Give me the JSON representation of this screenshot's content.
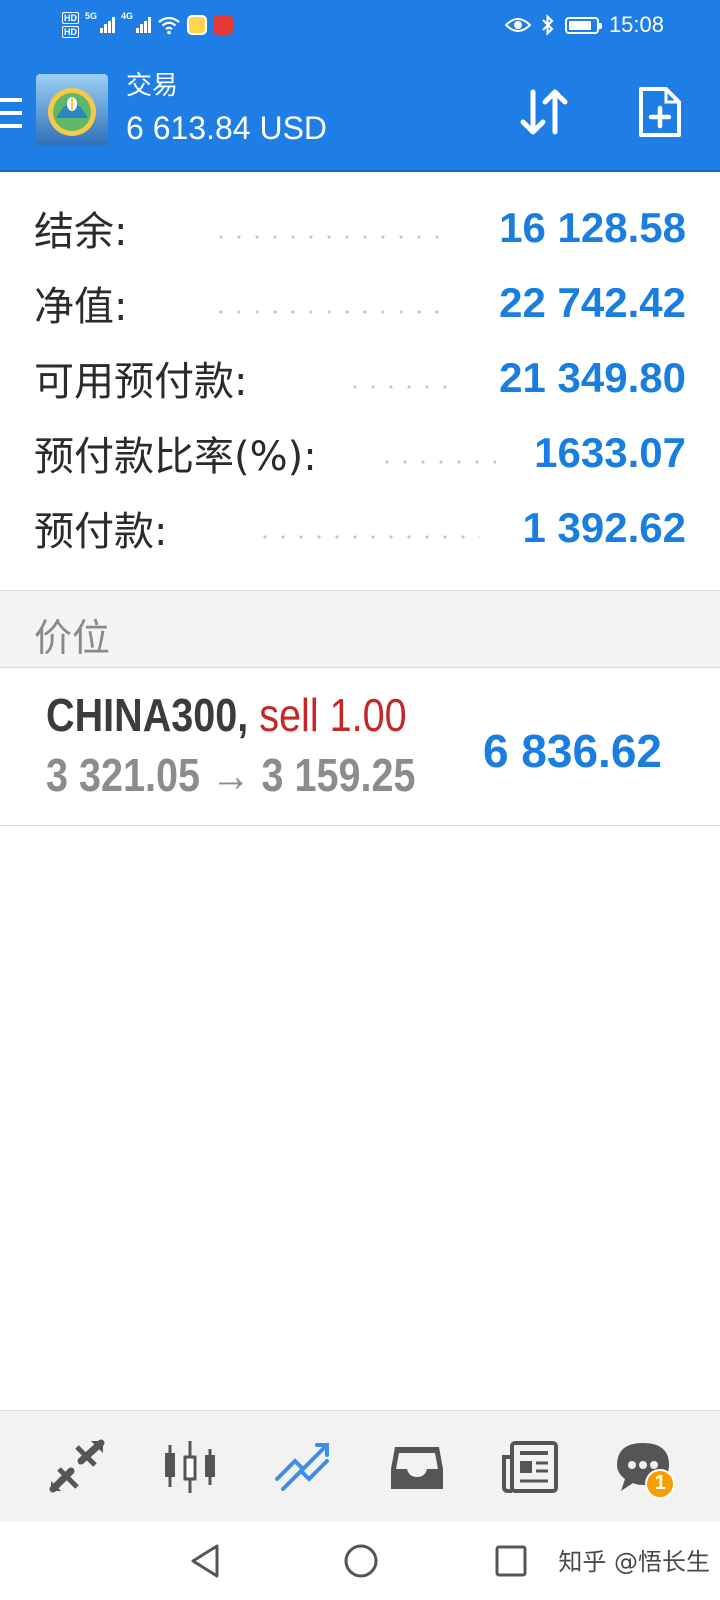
{
  "status_bar": {
    "time": "15:08",
    "sim1": "HD",
    "sim2": "HD",
    "network1": "5G",
    "network2": "4G"
  },
  "app_bar": {
    "title": "交易",
    "balance": "6 613.84 USD",
    "accent_color": "#1e7ee6"
  },
  "summary": [
    {
      "label": "结余:",
      "value": "16 128.58"
    },
    {
      "label": "净值:",
      "value": "22 742.42"
    },
    {
      "label": "可用预付款:",
      "value": "21 349.80"
    },
    {
      "label": "预付款比率(%):",
      "value": "1633.07"
    },
    {
      "label": "预付款:",
      "value": "1 392.62"
    }
  ],
  "section": {
    "title": "价位"
  },
  "position": {
    "symbol": "CHINA300",
    "comma": ",",
    "action": "sell 1.00",
    "prices": "3 321.05 → 3 159.25",
    "profit": "6 836.62",
    "action_color": "#c62828",
    "profit_color": "#1a7de0"
  },
  "bottom_nav": {
    "items": [
      {
        "icon": "quotes-icon",
        "active": false
      },
      {
        "icon": "chart-icon",
        "active": false
      },
      {
        "icon": "trade-icon",
        "active": true
      },
      {
        "icon": "history-icon",
        "active": false
      },
      {
        "icon": "news-icon",
        "active": false
      },
      {
        "icon": "messages-icon",
        "active": false
      }
    ],
    "messages_badge": "1"
  },
  "watermark": "知乎 @悟长生"
}
